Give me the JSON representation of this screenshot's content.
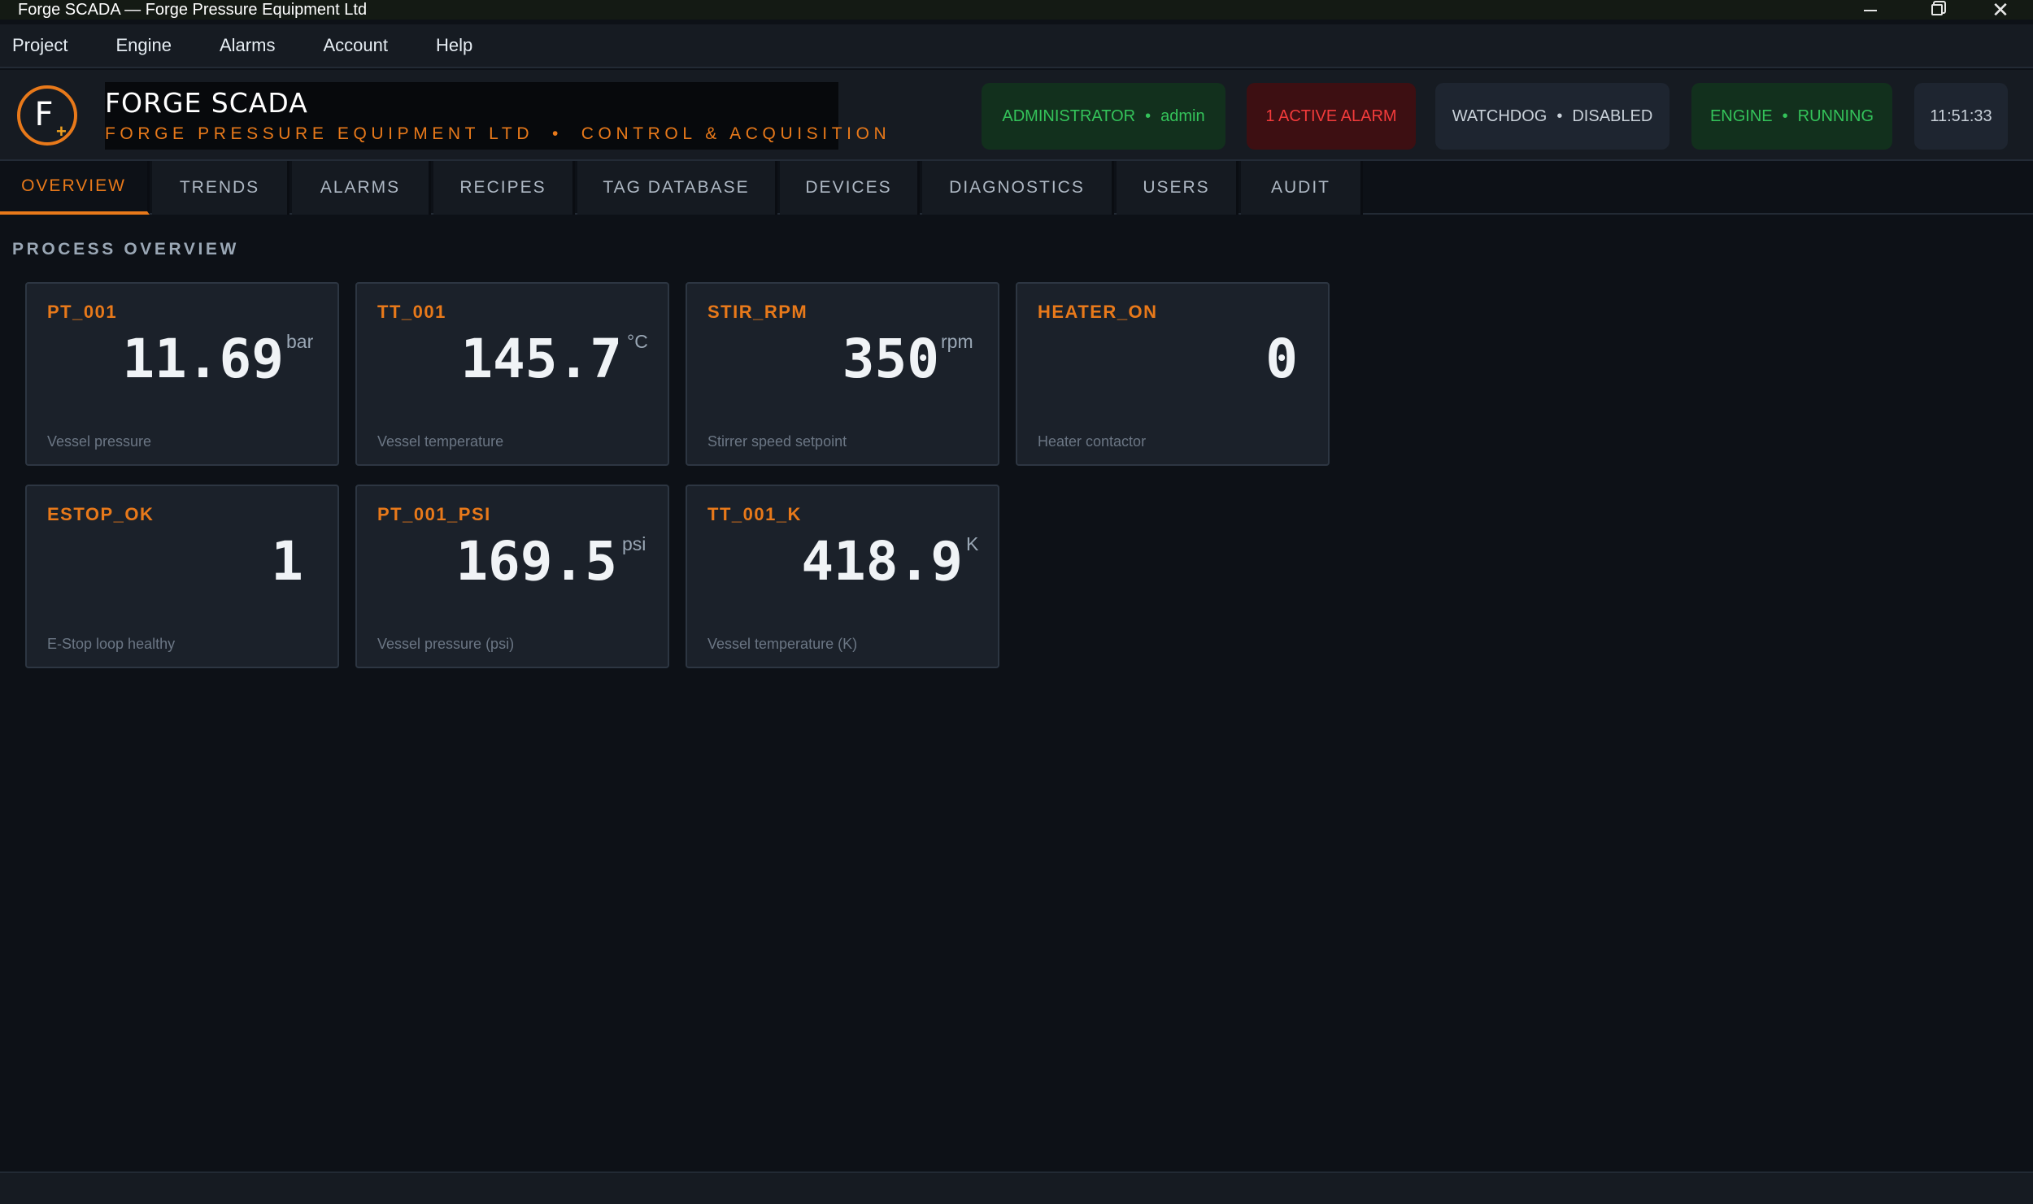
{
  "window": {
    "title": "Forge SCADA — Forge Pressure Equipment Ltd",
    "controls": {
      "minimize": "",
      "maximize": "",
      "close": "✕"
    }
  },
  "menu": [
    "Project",
    "Engine",
    "Alarms",
    "Account",
    "Help"
  ],
  "header": {
    "logo_letter": "F",
    "logo_mark": "+",
    "title": "FORGE SCADA",
    "subtitle": "FORGE PRESSURE EQUIPMENT LTD  •  CONTROL & ACQUISITION",
    "status": {
      "role": "ADMINISTRATOR",
      "user": "admin",
      "alarm": "1 ACTIVE ALARM",
      "watchdog_label": "WATCHDOG",
      "watchdog_state": "DISABLED",
      "engine_label": "ENGINE",
      "engine_state": "RUNNING",
      "separator": "•",
      "clock": "11:51:33"
    },
    "colors": {
      "accent": "#e8791a",
      "ok": "#34c35a",
      "alarm": "#f23b3b"
    }
  },
  "tabs": [
    "OVERVIEW",
    "TRENDS",
    "ALARMS",
    "RECIPES",
    "TAG DATABASE",
    "DEVICES",
    "DIAGNOSTICS",
    "USERS",
    "AUDIT"
  ],
  "active_tab": "OVERVIEW",
  "overview": {
    "title": "PROCESS OVERVIEW",
    "cards": [
      {
        "tag": "PT_001",
        "value": "11.69",
        "unit": "bar",
        "desc": "Vessel pressure"
      },
      {
        "tag": "TT_001",
        "value": "145.7",
        "unit": "°C",
        "desc": "Vessel temperature"
      },
      {
        "tag": "STIR_RPM",
        "value": "350",
        "unit": "rpm",
        "desc": "Stirrer speed setpoint"
      },
      {
        "tag": "HEATER_ON",
        "value": "0",
        "unit": "",
        "desc": "Heater contactor"
      },
      {
        "tag": "ESTOP_OK",
        "value": "1",
        "unit": "",
        "desc": "E-Stop loop healthy"
      },
      {
        "tag": "PT_001_PSI",
        "value": "169.5",
        "unit": "psi",
        "desc": "Vessel pressure (psi)"
      },
      {
        "tag": "TT_001_K",
        "value": "418.9",
        "unit": "K",
        "desc": "Vessel temperature (K)"
      }
    ]
  }
}
